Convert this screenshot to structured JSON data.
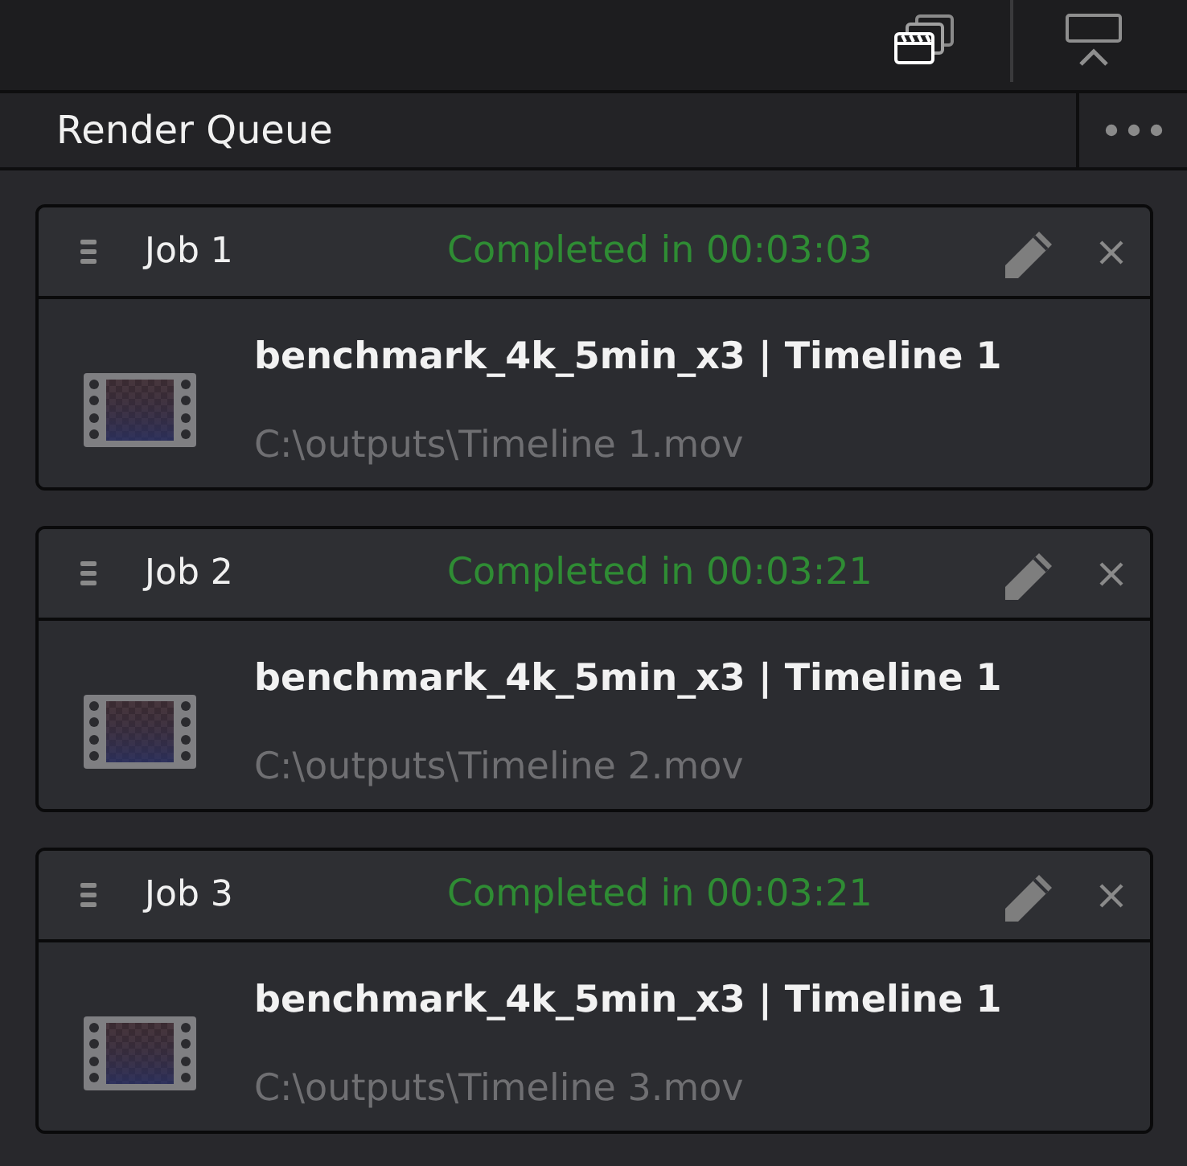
{
  "panel": {
    "title": "Render Queue"
  },
  "jobs": [
    {
      "name": "Job 1",
      "kind": "completed",
      "status": "Completed in 00:03:03",
      "title": "benchmark_4k_5min_x3 | Timeline 1",
      "path": "C:\\outputs\\Timeline 1.mov"
    },
    {
      "name": "Job 2",
      "kind": "completed",
      "status": "Completed in 00:03:21",
      "title": "benchmark_4k_5min_x3 | Timeline 1",
      "path": "C:\\outputs\\Timeline 2.mov"
    },
    {
      "name": "Job 3",
      "kind": "completed",
      "status": "Completed in 00:03:21",
      "title": "benchmark_4k_5min_x3 | Timeline 1",
      "path": "C:\\outputs\\Timeline 3.mov"
    }
  ]
}
